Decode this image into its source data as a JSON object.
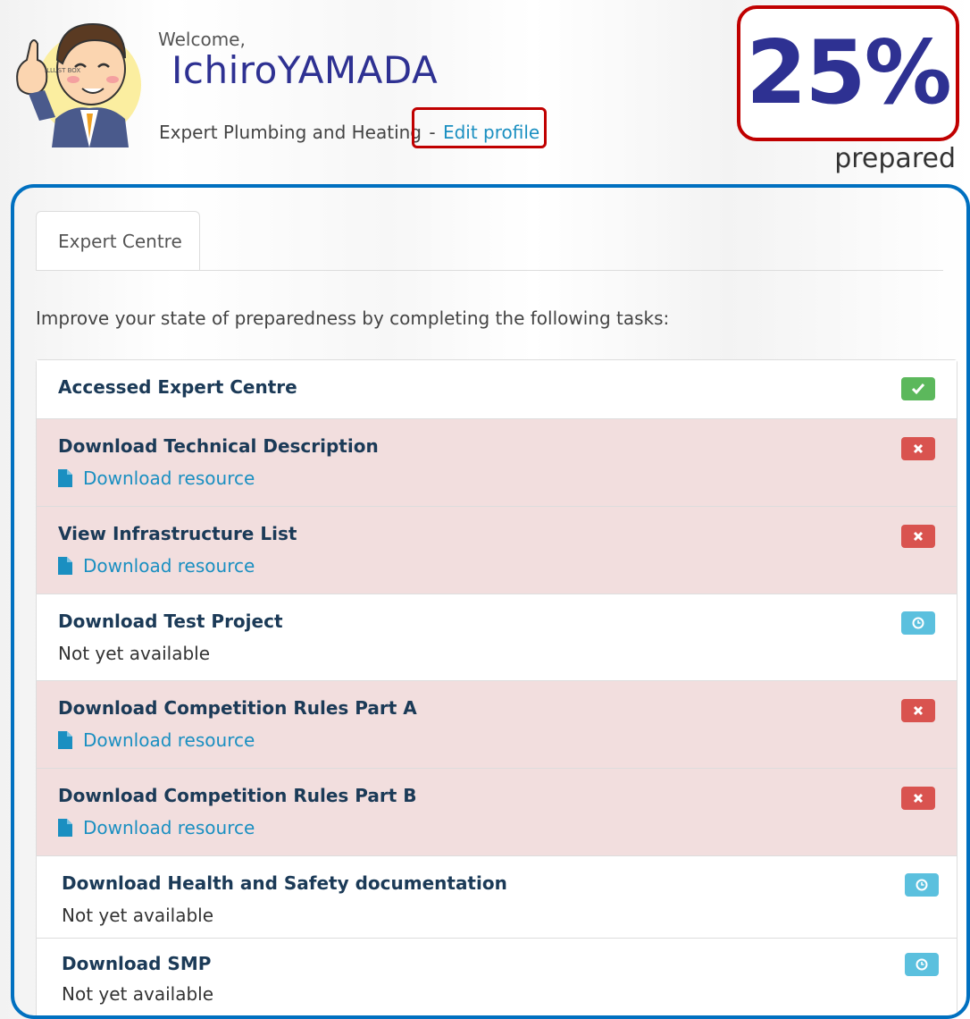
{
  "header": {
    "welcome": "Welcome,",
    "username": "IchiroYAMADA",
    "role": "Expert Plumbing and Heating",
    "separator": "-",
    "edit_profile": "Edit profile",
    "percent": "25%",
    "percent_caption": "prepared",
    "avatar_watermark": "ILLUST BOX"
  },
  "tabs": [
    {
      "label": "Expert Centre"
    }
  ],
  "intro": "Improve your state of preparedness by completing the following tasks:",
  "tasks": [
    {
      "title": "Accessed Expert Centre",
      "status": "done",
      "status_icon": "check-icon"
    },
    {
      "title": "Download Technical Description",
      "status": "missing",
      "status_icon": "times-icon",
      "link": "Download resource"
    },
    {
      "title": "View Infrastructure List",
      "status": "missing",
      "status_icon": "times-icon",
      "link": "Download resource"
    },
    {
      "title": "Download Test Project",
      "status": "pending",
      "status_icon": "clock-icon",
      "note": "Not yet available"
    },
    {
      "title": "Download Competition Rules Part A",
      "status": "missing",
      "status_icon": "times-icon",
      "link": "Download resource"
    },
    {
      "title": "Download Competition Rules Part B",
      "status": "missing",
      "status_icon": "times-icon",
      "link": "Download resource"
    },
    {
      "title": "Download Health and Safety documentation",
      "status": "pending",
      "status_icon": "clock-icon",
      "note": "Not yet available"
    },
    {
      "title": "Download SMP",
      "status": "pending",
      "status_icon": "clock-icon",
      "note": "Not yet available"
    }
  ],
  "colors": {
    "username": "#2e3192",
    "link": "#1a8fc1",
    "task_title": "#1b3a57",
    "failed_row": "#f2dede",
    "badge_done": "#5cb85c",
    "badge_missing": "#d9534f",
    "badge_pending": "#5bc0de",
    "highlight_red": "#c00000",
    "panel_blue": "#0070c0"
  }
}
